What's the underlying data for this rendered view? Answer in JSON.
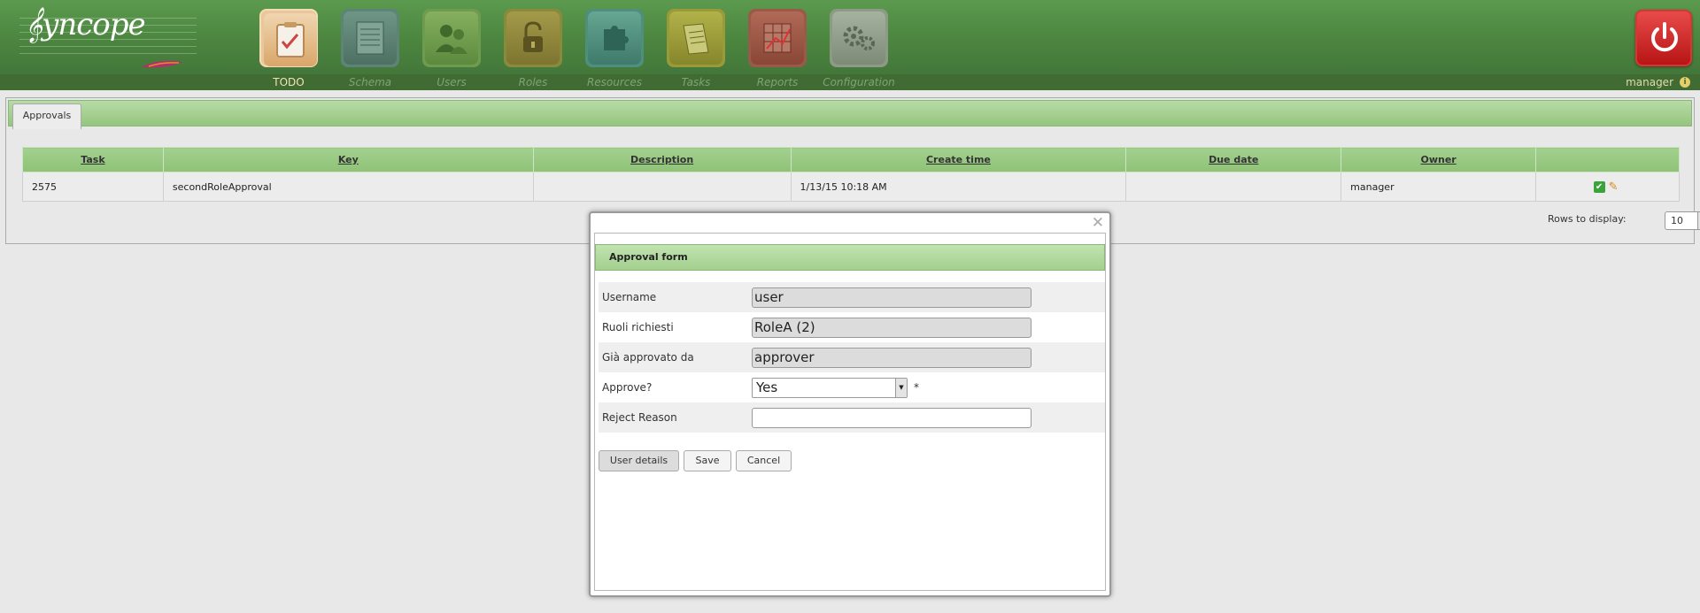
{
  "header": {
    "logo_text": "yncope",
    "nav": [
      {
        "label": "TODO",
        "icon": "todo-clipboard-icon",
        "active": true
      },
      {
        "label": "Schema",
        "icon": "schema-icon",
        "active": false
      },
      {
        "label": "Users",
        "icon": "users-icon",
        "active": false
      },
      {
        "label": "Roles",
        "icon": "roles-lock-icon",
        "active": false
      },
      {
        "label": "Resources",
        "icon": "resources-puzzle-icon",
        "active": false
      },
      {
        "label": "Tasks",
        "icon": "tasks-icon",
        "active": false
      },
      {
        "label": "Reports",
        "icon": "reports-chart-icon",
        "active": false
      },
      {
        "label": "Configuration",
        "icon": "configuration-gears-icon",
        "active": false
      }
    ],
    "user": "manager",
    "info_glyph": "i",
    "power_icon": "power-icon"
  },
  "tabs": {
    "approvals": "Approvals"
  },
  "table": {
    "columns": [
      "Task",
      "Key",
      "Description",
      "Create time",
      "Due date",
      "Owner",
      ""
    ],
    "rows": [
      {
        "task": "2575",
        "key": "secondRoleApproval",
        "description": "",
        "create_time": "1/13/15 10:18 AM",
        "due_date": "",
        "owner": "manager"
      }
    ]
  },
  "pagination": {
    "rows_label": "Rows to display:",
    "rows_value": "10"
  },
  "modal": {
    "close_glyph": "✕",
    "title": "Approval form",
    "fields": {
      "username": {
        "label": "Username",
        "value": "user"
      },
      "ruoli": {
        "label": "Ruoli richiesti",
        "value": "RoleA (2)"
      },
      "approvato": {
        "label": "Già approvato da",
        "value": "approver"
      },
      "approve": {
        "label": "Approve?",
        "value": "Yes",
        "required_mark": "*"
      },
      "reject": {
        "label": "Reject Reason",
        "value": ""
      }
    },
    "buttons": {
      "user_details": "User details",
      "save": "Save",
      "cancel": "Cancel"
    }
  }
}
